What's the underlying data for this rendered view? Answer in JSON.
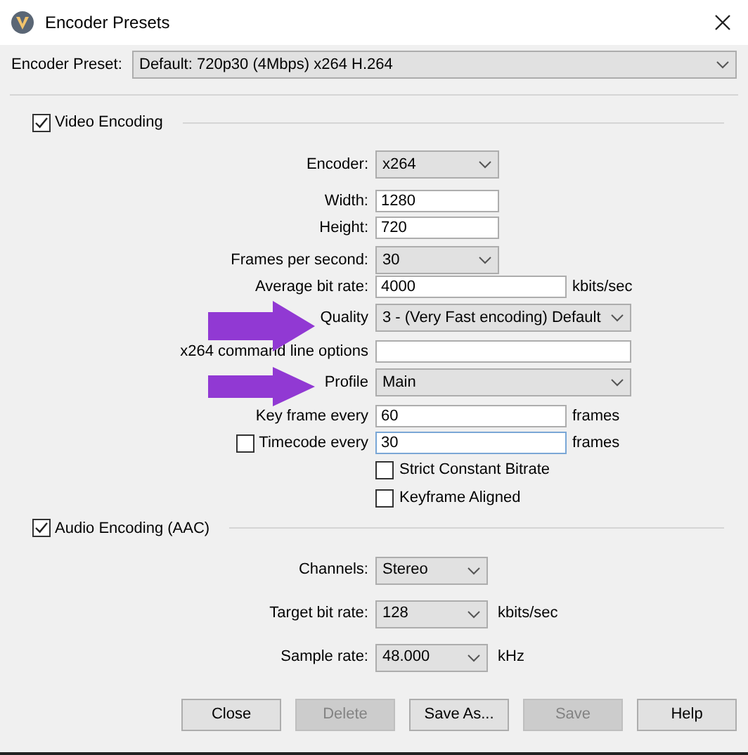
{
  "window": {
    "title": "Encoder Presets"
  },
  "preset": {
    "label": "Encoder Preset:",
    "value": "Default: 720p30 (4Mbps) x264 H.264"
  },
  "video": {
    "label": "Video Encoding",
    "checked": true,
    "rows": [
      {
        "kind": "dropdown",
        "label": "Encoder:",
        "value": "x264"
      },
      {
        "kind": "input",
        "label": "Width:",
        "value": "1280"
      },
      {
        "kind": "input",
        "label": "Height:",
        "value": "720"
      },
      {
        "kind": "dropdown",
        "label": "Frames per second:",
        "value": "30"
      },
      {
        "kind": "input",
        "label": "Average bit rate:",
        "value": "4000",
        "unit": "kbits/sec"
      },
      {
        "kind": "dropdown",
        "label": "Quality",
        "value": "3 - (Very Fast encoding) Default"
      },
      {
        "kind": "input",
        "label": "x264 command line options"
      },
      {
        "kind": "dropdown",
        "label": "Profile",
        "value": "Main"
      },
      {
        "kind": "input",
        "label": "Key frame every",
        "value": "60",
        "unit": "frames"
      },
      {
        "kind": "checkinput",
        "label": "Timecode every",
        "checked": false,
        "value": "30",
        "unit": "frames"
      },
      {
        "kind": "checkbox",
        "label": "Strict Constant Bitrate",
        "checked": false
      },
      {
        "kind": "checkbox",
        "label": "Keyframe Aligned",
        "checked": false
      }
    ]
  },
  "audio": {
    "label": "Audio Encoding (AAC)",
    "checked": true,
    "rows": [
      {
        "label": "Channels:",
        "value": "Stereo"
      },
      {
        "label": "Target bit rate:",
        "value": "128",
        "unit": "kbits/sec"
      },
      {
        "label": "Sample rate:",
        "value": "48.000",
        "unit": "kHz"
      }
    ]
  },
  "buttons": [
    {
      "label": "Close",
      "disabled": false
    },
    {
      "label": "Delete",
      "disabled": true
    },
    {
      "label": "Save As...",
      "disabled": false
    },
    {
      "label": "Save",
      "disabled": true
    },
    {
      "label": "Help",
      "disabled": false
    }
  ]
}
